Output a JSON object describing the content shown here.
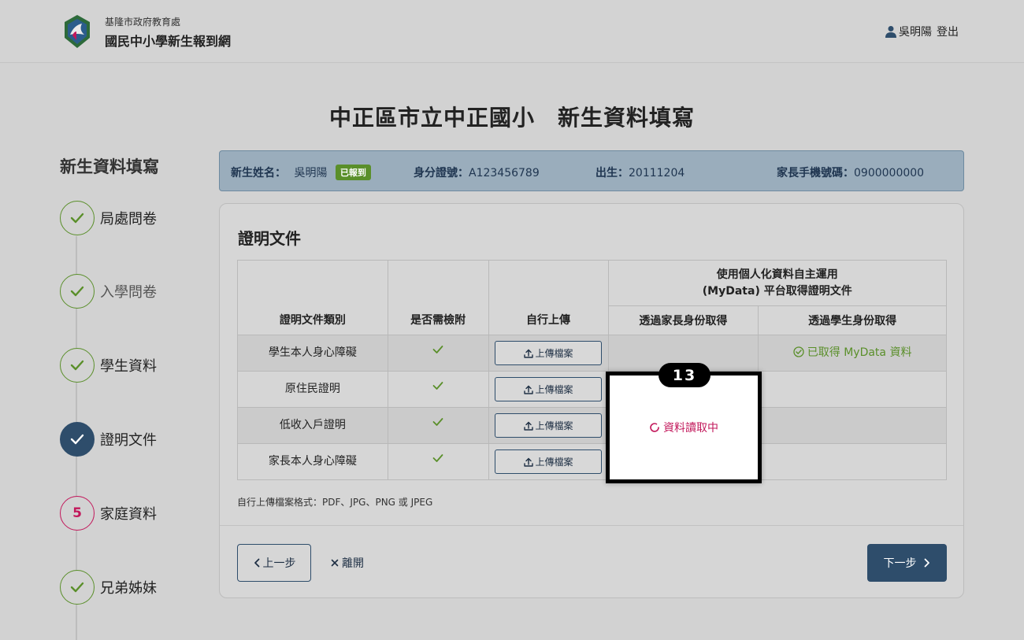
{
  "header": {
    "agency": "基隆市政府教育處",
    "site_name": "國民中小學新生報到網",
    "user_name": "吳明陽",
    "logout_label": "登出"
  },
  "page_title": "中正區市立中正國小　新生資料填寫",
  "sidebar": {
    "title": "新生資料填寫",
    "steps": [
      {
        "label": "局處問卷",
        "state": "done"
      },
      {
        "label": "入學問卷",
        "state": "done"
      },
      {
        "label": "學生資料",
        "state": "done"
      },
      {
        "label": "證明文件",
        "state": "current"
      },
      {
        "label": "家庭資料",
        "state": "pending",
        "number": "5"
      },
      {
        "label": "兄弟姊妹",
        "state": "done"
      }
    ]
  },
  "student_info": {
    "name_key": "新生姓名：",
    "name_value": "吳明陽",
    "status_badge": "已報到",
    "id_key": "身分證號：",
    "id_value": "A123456789",
    "birth_key": "出生：",
    "birth_value": "20111204",
    "phone_key": "家長手機號碼：",
    "phone_value": "0900000000"
  },
  "card": {
    "title": "證明文件",
    "table": {
      "headers": {
        "doc_type": "證明文件類別",
        "required": "是否需檢附",
        "self_upload": "自行上傳",
        "mydata_group_line1": "使用個人化資料自主運用",
        "mydata_group_line2": "(MyData) 平台取得證明文件",
        "via_parent": "透過家長身份取得",
        "via_student": "透過學生身份取得"
      },
      "upload_label": "上傳檔案",
      "rows": [
        {
          "doc": "學生本人身心障礙",
          "student_status": "已取得 MyData 資料"
        },
        {
          "doc": "原住民證明"
        },
        {
          "doc": "低收入戶證明"
        },
        {
          "doc": "家長本人身心障礙"
        }
      ]
    },
    "note": "自行上傳檔案格式：PDF、JPG、PNG 或 JPEG",
    "prev_label": "上一步",
    "leave_label": "離開",
    "next_label": "下一步"
  },
  "popup": {
    "loading_text": "資料讀取中",
    "marker": "13"
  },
  "colors": {
    "primary": "#2e4d6b",
    "success": "#5a8f2a",
    "alert": "#c2185b"
  }
}
